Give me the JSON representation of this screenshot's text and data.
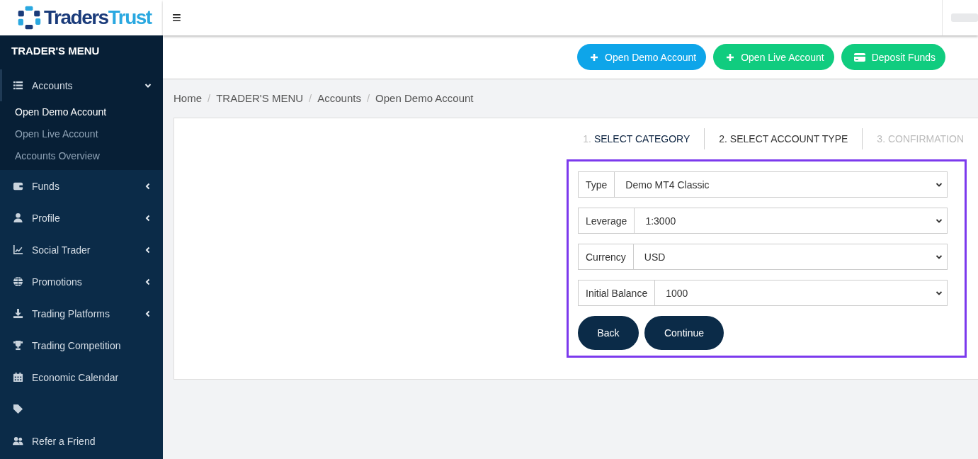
{
  "brand": {
    "name_dark": "Traders",
    "name_light": "Trust"
  },
  "sidebar": {
    "title": "TRADER'S MENU",
    "items": [
      {
        "label": "Accounts",
        "has_submenu": true,
        "expanded": true,
        "children": [
          {
            "label": "Open Demo Account",
            "selected": true
          },
          {
            "label": "Open Live Account",
            "selected": false
          },
          {
            "label": "Accounts Overview",
            "selected": false
          }
        ]
      },
      {
        "label": "Funds",
        "has_submenu": true,
        "expanded": false
      },
      {
        "label": "Profile",
        "has_submenu": true,
        "expanded": false
      },
      {
        "label": "Social Trader",
        "has_submenu": true,
        "expanded": false
      },
      {
        "label": "Promotions",
        "has_submenu": true,
        "expanded": false
      },
      {
        "label": "Trading Platforms",
        "has_submenu": true,
        "expanded": false
      },
      {
        "label": "Trading Competition",
        "has_submenu": false
      },
      {
        "label": "Economic Calendar",
        "has_submenu": false
      },
      {
        "has_submenu": false
      },
      {
        "label": "Refer a Friend",
        "has_submenu": false
      }
    ]
  },
  "topbar": {
    "menu_glyph": "≡"
  },
  "actions": [
    {
      "label": "Open Demo Account",
      "kind": "plus",
      "color": "#0ea5e9"
    },
    {
      "label": "Open Live Account",
      "kind": "plus",
      "color": "#10cc7f"
    },
    {
      "label": "Deposit Funds",
      "kind": "card",
      "color": "#10cc7f"
    }
  ],
  "breadcrumb": [
    {
      "label": "Home"
    },
    {
      "separator": "/",
      "label": "TRADER'S MENU"
    },
    {
      "separator": "/",
      "label": "Accounts"
    },
    {
      "separator": "/",
      "label": "Open Demo Account"
    }
  ],
  "steps": [
    {
      "number": "1.",
      "label": "SELECT CATEGORY",
      "completed": true,
      "selected": false
    },
    {
      "number": "2.",
      "label": "SELECT ACCOUNT TYPE",
      "completed": false,
      "selected": true
    },
    {
      "number": "3.",
      "label": "CONFIRMATION",
      "completed": false,
      "selected": false
    }
  ],
  "form": {
    "fields": [
      {
        "label": "Type",
        "value": "Demo MT4 Classic"
      },
      {
        "label": "Leverage",
        "value": "1:3000"
      },
      {
        "label": "Currency",
        "value": "USD"
      },
      {
        "label": "Initial Balance",
        "value": "1000"
      }
    ],
    "buttons": [
      "Back",
      "Continue"
    ]
  }
}
